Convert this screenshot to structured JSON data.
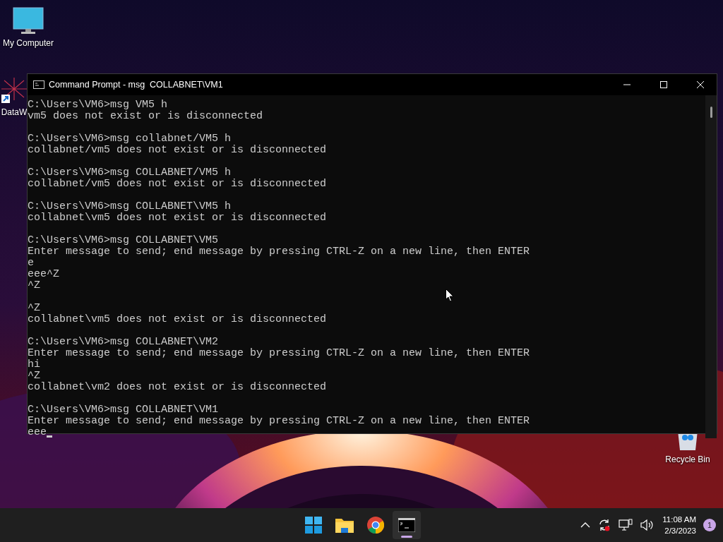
{
  "desktop": {
    "icons": [
      {
        "label": "My Computer",
        "kind": "computer"
      },
      {
        "label": "DataW",
        "kind": "shortcut"
      },
      {
        "label": "Recycle Bin",
        "kind": "bin"
      }
    ]
  },
  "window": {
    "title": "Command Prompt - msg  COLLABNET\\VM1",
    "console": {
      "blocks": [
        [
          "C:\\Users\\VM6>msg VM5 h",
          "vm5 does not exist or is disconnected"
        ],
        [
          "C:\\Users\\VM6>msg collabnet/VM5 h",
          "collabnet/vm5 does not exist or is disconnected"
        ],
        [
          "C:\\Users\\VM6>msg COLLABNET/VM5 h",
          "collabnet/vm5 does not exist or is disconnected"
        ],
        [
          "C:\\Users\\VM6>msg COLLABNET\\VM5 h",
          "collabnet\\vm5 does not exist or is disconnected"
        ],
        [
          "C:\\Users\\VM6>msg COLLABNET\\VM5",
          "Enter message to send; end message by pressing CTRL-Z on a new line, then ENTER",
          "e",
          "eee^Z",
          "^Z"
        ],
        [
          "^Z",
          "collabnet\\vm5 does not exist or is disconnected"
        ],
        [
          "C:\\Users\\VM6>msg COLLABNET\\VM2",
          "Enter message to send; end message by pressing CTRL-Z on a new line, then ENTER",
          "hi",
          "^Z",
          "collabnet\\vm2 does not exist or is disconnected"
        ],
        [
          "C:\\Users\\VM6>msg COLLABNET\\VM1",
          "Enter message to send; end message by pressing CTRL-Z on a new line, then ENTER",
          "eee"
        ]
      ]
    }
  },
  "taskbar": {
    "apps": [
      {
        "kind": "start",
        "selected": false
      },
      {
        "kind": "explorer",
        "selected": false
      },
      {
        "kind": "browser",
        "selected": false
      },
      {
        "kind": "terminal",
        "selected": true
      }
    ],
    "tray": {
      "time": "11:08 AM",
      "date": "2/3/2023",
      "notifications": "1"
    }
  }
}
